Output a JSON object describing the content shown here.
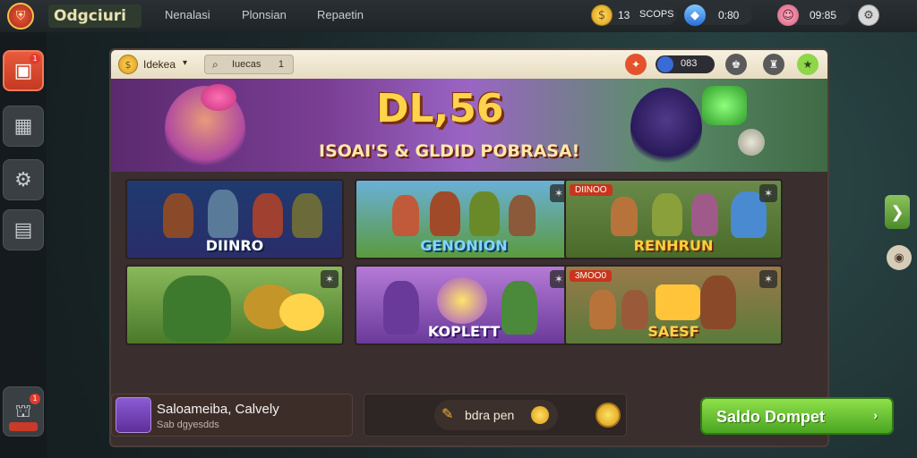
{
  "topbar": {
    "logo_icon": "shield-emblem",
    "app_title": "Odgciuri",
    "nav": [
      "Nenalasi",
      "Plonsian",
      "Repaetin"
    ],
    "coins_count": "13",
    "coins_label": "SCOPS",
    "gems_count": "0:80",
    "timer": "09:85"
  },
  "sidebar": {
    "items": [
      {
        "icon": "home-icon",
        "active": true,
        "badge": "1"
      },
      {
        "icon": "grid-icon",
        "active": false
      },
      {
        "icon": "gear-icon",
        "active": false
      },
      {
        "icon": "box-icon",
        "active": false
      }
    ],
    "bottom_icon": "mushroom-icon",
    "bottom_badge": "1"
  },
  "panel": {
    "label": "Idekea",
    "search_value": "Iuecas",
    "search_count": "1",
    "balance": "083"
  },
  "banner": {
    "title": "DL,56",
    "subtitle": "ISOAI'S & GLDID POBRASA!"
  },
  "games": [
    {
      "label": "DIINRO",
      "theme": "dark"
    },
    {
      "label": "GENONION",
      "theme": "green"
    },
    {
      "label": "RENHRUN",
      "theme": "forest",
      "badge": "DIINOO"
    },
    {
      "label": "",
      "theme": "goblin"
    },
    {
      "label": "KOPLETT",
      "theme": "purple"
    },
    {
      "label": "SAESF",
      "theme": "gold",
      "badge": "3MOO0"
    }
  ],
  "footer": {
    "player_name": "Saloameiba, Calvely",
    "player_sub": "Sab dgyesdds",
    "mid_text": "bdra pen",
    "cta_label": "Saldo Dompet"
  },
  "colors": {
    "accent_red": "#e4512f",
    "cta_green": "#6cc433",
    "gold": "#ffd34a"
  }
}
